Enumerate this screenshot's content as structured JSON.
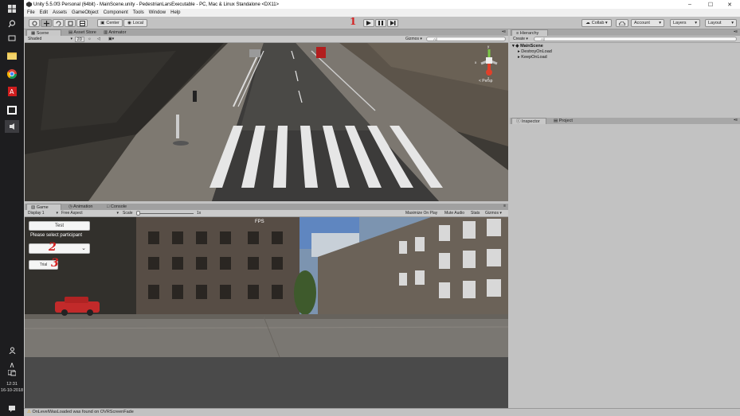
{
  "window": {
    "title": "Unity 5.5.0f3 Personal (64bit) - MainScene.unity - PedestrianLarsExecutable - PC, Mac & Linux Standalone <DX11>",
    "minimize": "–",
    "maximize": "☐",
    "close": "✕"
  },
  "menu": [
    "File",
    "Edit",
    "Assets",
    "GameObject",
    "Component",
    "Tools",
    "Window",
    "Help"
  ],
  "toolbar": {
    "pivot": "Center",
    "space": "Local",
    "collab": "Collab ▾",
    "account": "Account",
    "layers": "Layers",
    "layout": "Layout",
    "marker_play": "1"
  },
  "scene_panel": {
    "tabs": [
      "Scene",
      "Asset Store",
      "Animator"
    ],
    "shading": "Shaded",
    "mode2d": "2D",
    "gizmos": "Gizmos ▾",
    "search_placeholder": "All",
    "persp": "< Persp",
    "axis_y": "y",
    "axis_x": "x",
    "axis_z": "z"
  },
  "game_panel": {
    "tabs": [
      "Game",
      "Animation",
      "Console"
    ],
    "display": "Display 1",
    "aspect": "Free Aspect",
    "scale_label": "Scale",
    "scale_value": "1x",
    "buttons": [
      "Maximize On Play",
      "Mute Audio",
      "Stats",
      "Gizmos ▾"
    ],
    "fps": "FPS",
    "test_button": "Test",
    "prompt": "Please select participant",
    "trial_button": "Trial",
    "marker_dropdown": "2",
    "marker_trial": "3"
  },
  "hierarchy": {
    "tab": "Hierarchy",
    "create": "Create ▾",
    "search_placeholder": "All",
    "scene": "MainScene",
    "items": [
      "DestroyOnLoad",
      "KeepOnLoad"
    ]
  },
  "inspector": {
    "tabs": [
      "Inspector",
      "Project"
    ]
  },
  "status": {
    "message": "OnLevelWasLoaded was found on OVRScreenFade"
  },
  "taskbar": {
    "time": "12:31",
    "date": "16-10-2018"
  }
}
